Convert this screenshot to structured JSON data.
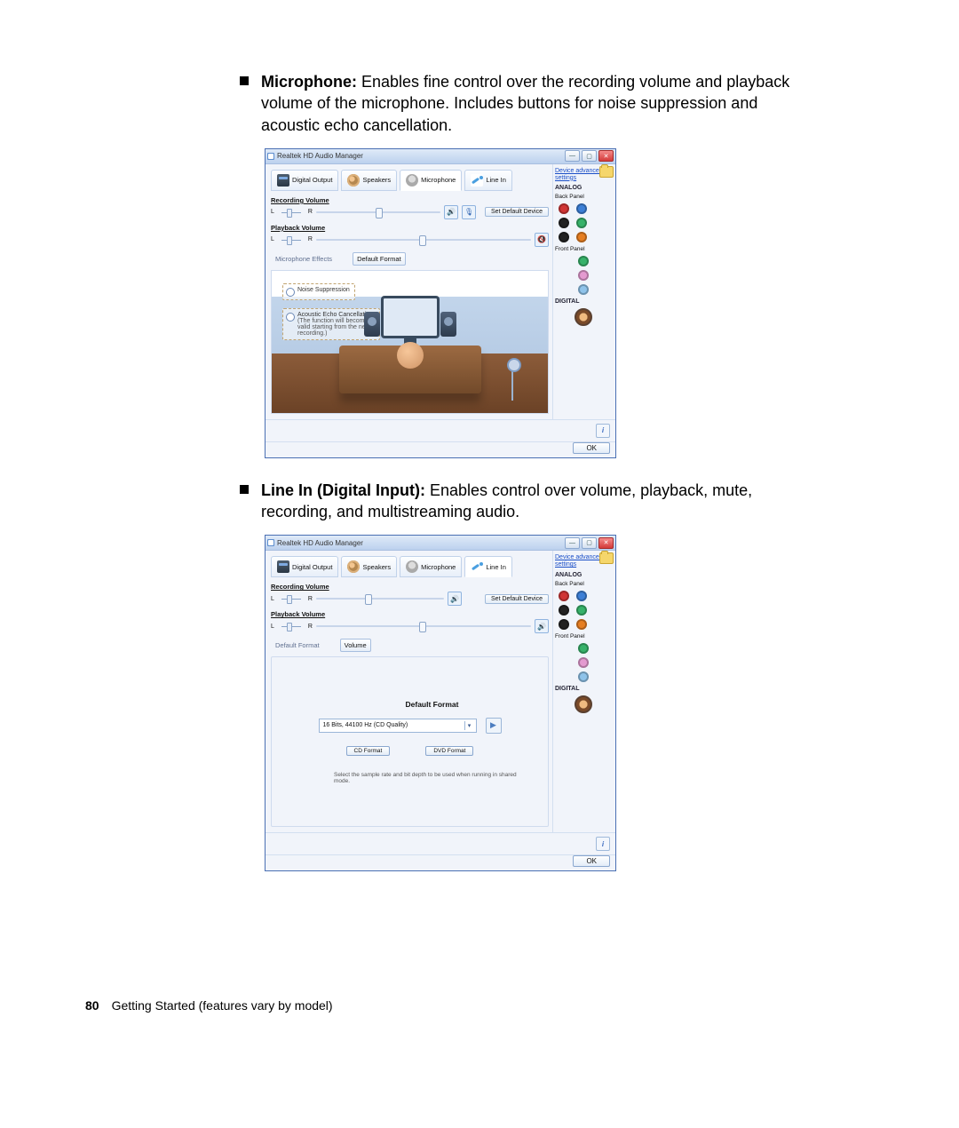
{
  "doc": {
    "page_number": "80",
    "footer_text": "Getting Started (features vary by model)",
    "bullets": {
      "b1": {
        "label": "Microphone:",
        "desc": " Enables fine control over the recording volume and playback volume of the microphone. Includes buttons for noise suppression and acoustic echo cancellation."
      },
      "b2": {
        "label": "Line In (Digital Input):",
        "desc": " Enables control over volume, playback, mute, recording, and multistreaming audio."
      }
    }
  },
  "common_ui": {
    "app_title": "Realtek HD Audio Manager",
    "tabs": {
      "digital": "Digital Output",
      "speakers": "Speakers",
      "microphone": "Microphone",
      "linein": "Line In"
    },
    "side": {
      "adv_link": "Device advanced settings",
      "analog": "ANALOG",
      "back_panel": "Back Panel",
      "front_panel": "Front Panel",
      "digital": "DIGITAL"
    },
    "recording_volume": "Recording Volume",
    "playback_volume": "Playback Volume",
    "set_default": "Set Default Device",
    "ok": "OK",
    "L": "L",
    "R": "R"
  },
  "mic_shot": {
    "sub_tabs": {
      "effects": "Microphone Effects",
      "default_format": "Default Format"
    },
    "noise_suppression": "Noise Suppression",
    "aec_line1": "Acoustic Echo Cancellation",
    "aec_line2": "(The function will become valid starting from the next recording.)"
  },
  "linein_shot": {
    "sub_tabs": {
      "default_format": "Default Format",
      "volume": "Volume"
    },
    "format_heading": "Default Format",
    "dropdown_value": "16 Bits, 44100 Hz (CD Quality)",
    "cd_format": "CD Format",
    "dvd_format": "DVD Format",
    "help_text": "Select the sample rate and bit depth to be used when running in shared mode."
  }
}
